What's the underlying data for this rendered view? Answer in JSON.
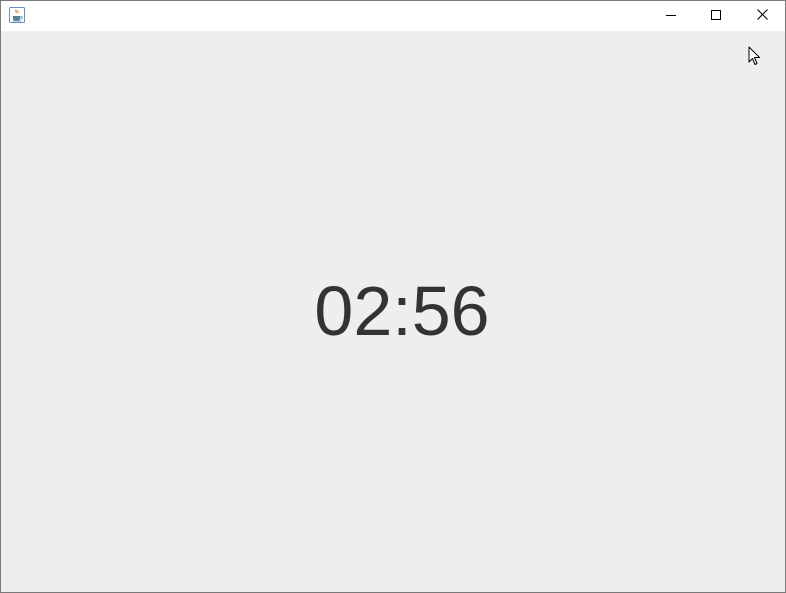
{
  "window": {
    "icon": "java-coffee-cup-icon",
    "controls": {
      "minimize_icon": "minimize-icon",
      "maximize_icon": "maximize-icon",
      "close_icon": "close-icon"
    }
  },
  "timer": {
    "display": "02:56",
    "color": "#333333"
  },
  "colors": {
    "background": "#eeeeee",
    "titlebar": "#ffffff"
  }
}
